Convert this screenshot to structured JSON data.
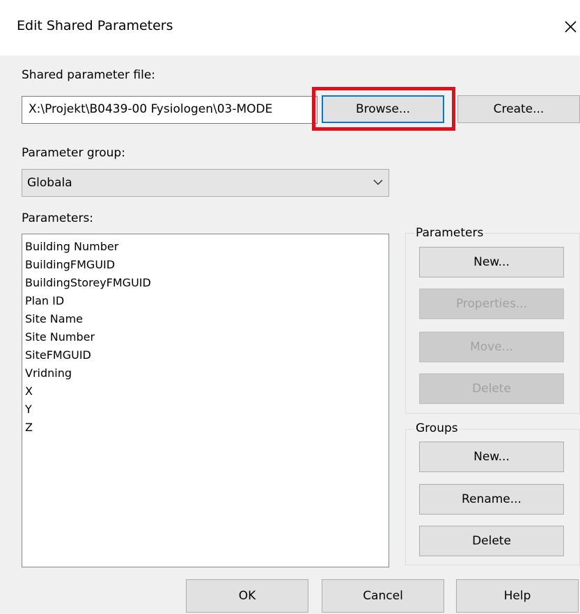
{
  "window": {
    "title": "Edit Shared Parameters"
  },
  "file_section": {
    "label": "Shared parameter file:",
    "path_value": "X:\\Projekt\\B0439-00 Fysiologen\\03-MODE",
    "browse_label": "Browse...",
    "create_label": "Create..."
  },
  "group_section": {
    "label": "Parameter group:",
    "selected_value": "Globala"
  },
  "parameters_section": {
    "label": "Parameters:",
    "items": [
      "Building Number",
      "BuildingFMGUID",
      "BuildingStoreyFMGUID",
      "Plan ID",
      "Site Name",
      "Site Number",
      "SiteFMGUID",
      "Vridning",
      "X",
      "Y",
      "Z"
    ]
  },
  "parameters_group": {
    "legend": "Parameters",
    "new_label": "New...",
    "properties_label": "Properties...",
    "move_label": "Move...",
    "delete_label": "Delete"
  },
  "groups_group": {
    "legend": "Groups",
    "new_label": "New...",
    "rename_label": "Rename...",
    "delete_label": "Delete"
  },
  "footer": {
    "ok_label": "OK",
    "cancel_label": "Cancel",
    "help_label": "Help"
  },
  "colors": {
    "highlight_box": "#e0101b",
    "focus_border": "#0078d7",
    "client_background": "#f0f0f0"
  }
}
